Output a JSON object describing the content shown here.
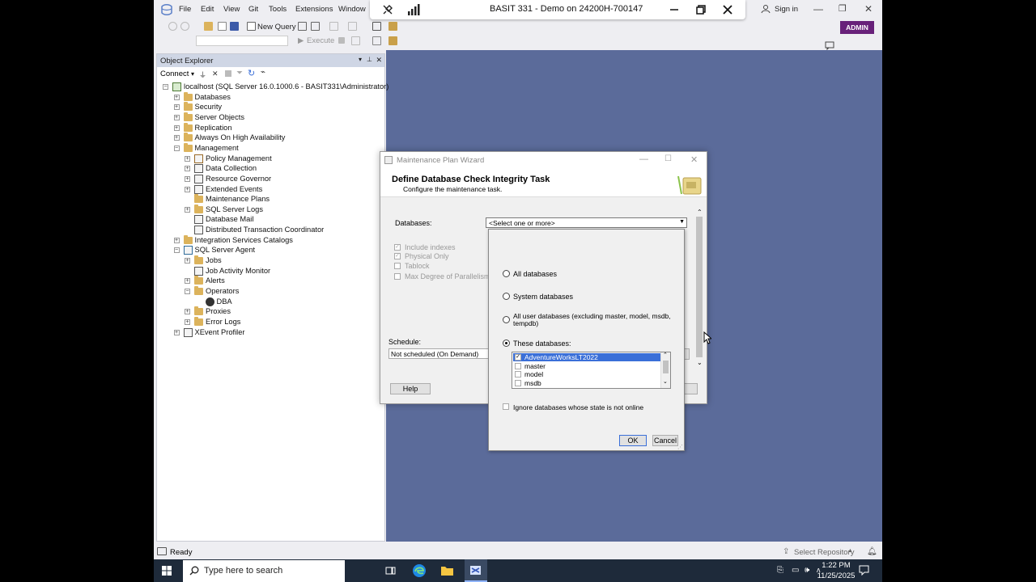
{
  "app": {
    "menu": [
      "File",
      "Edit",
      "View",
      "Git",
      "Tools",
      "Extensions",
      "Window"
    ],
    "sign_in": "Sign in",
    "admin": "ADMIN",
    "rdp_title": "BASIT 331 - Demo on 24200H-700147"
  },
  "toolbar": {
    "new_query": "New Query",
    "execute": "Execute"
  },
  "object_explorer": {
    "title": "Object Explorer",
    "connect": "Connect",
    "tree": [
      {
        "label": "localhost (SQL Server 16.0.1000.6 - BASIT331\\Administrator)",
        "level": 0,
        "exp": "-",
        "icon": "server"
      },
      {
        "label": "Databases",
        "level": 1,
        "exp": "+",
        "icon": "folder"
      },
      {
        "label": "Security",
        "level": 1,
        "exp": "+",
        "icon": "folder"
      },
      {
        "label": "Server Objects",
        "level": 1,
        "exp": "+",
        "icon": "folder"
      },
      {
        "label": "Replication",
        "level": 1,
        "exp": "+",
        "icon": "folder"
      },
      {
        "label": "Always On High Availability",
        "level": 1,
        "exp": "+",
        "icon": "folder"
      },
      {
        "label": "Management",
        "level": 1,
        "exp": "-",
        "icon": "folder"
      },
      {
        "label": "Policy Management",
        "level": 2,
        "exp": "+",
        "icon": "policy"
      },
      {
        "label": "Data Collection",
        "level": 2,
        "exp": "+",
        "icon": "datacollection"
      },
      {
        "label": "Resource Governor",
        "level": 2,
        "exp": "+",
        "icon": "governor"
      },
      {
        "label": "Extended Events",
        "level": 2,
        "exp": "+",
        "icon": "events"
      },
      {
        "label": "Maintenance Plans",
        "level": 2,
        "exp": "",
        "icon": "folder"
      },
      {
        "label": "SQL Server Logs",
        "level": 2,
        "exp": "+",
        "icon": "folder"
      },
      {
        "label": "Database Mail",
        "level": 2,
        "exp": "",
        "icon": "mail"
      },
      {
        "label": "Distributed Transaction Coordinator",
        "level": 2,
        "exp": "",
        "icon": "dtc"
      },
      {
        "label": "Integration Services Catalogs",
        "level": 1,
        "exp": "+",
        "icon": "folder"
      },
      {
        "label": "SQL Server Agent",
        "level": 1,
        "exp": "-",
        "icon": "agent"
      },
      {
        "label": "Jobs",
        "level": 2,
        "exp": "+",
        "icon": "folder"
      },
      {
        "label": "Job Activity Monitor",
        "level": 2,
        "exp": "",
        "icon": "monitor"
      },
      {
        "label": "Alerts",
        "level": 2,
        "exp": "+",
        "icon": "folder"
      },
      {
        "label": "Operators",
        "level": 2,
        "exp": "-",
        "icon": "folder"
      },
      {
        "label": "DBA",
        "level": 3,
        "exp": "",
        "icon": "user"
      },
      {
        "label": "Proxies",
        "level": 2,
        "exp": "+",
        "icon": "folder"
      },
      {
        "label": "Error Logs",
        "level": 2,
        "exp": "+",
        "icon": "folder"
      },
      {
        "label": "XEvent Profiler",
        "level": 1,
        "exp": "+",
        "icon": "events"
      }
    ]
  },
  "wizard": {
    "title": "Maintenance Plan Wizard",
    "header_title": "Define Database Check Integrity Task",
    "header_subtitle": "Configure the maintenance task.",
    "databases_label": "Databases:",
    "databases_value": "<Select one or more>",
    "include_indexes": "Include indexes",
    "physical_only": "Physical Only",
    "tablock": "Tablock",
    "max_dop": "Max Degree of Parallelism",
    "schedule_label": "Schedule:",
    "schedule_value": "Not scheduled (On Demand)",
    "help": "Help"
  },
  "popup": {
    "all_databases": "All databases",
    "system_databases": "System databases",
    "all_user_databases": "All user databases  (excluding master, model, msdb,",
    "all_user_databases_2": "tempdb)",
    "these_databases": "These databases:",
    "selected_option": "these",
    "databases": [
      {
        "name": "AdventureWorksLT2022",
        "checked": true,
        "selected": true
      },
      {
        "name": "master",
        "checked": false,
        "selected": false
      },
      {
        "name": "model",
        "checked": false,
        "selected": false
      },
      {
        "name": "msdb",
        "checked": false,
        "selected": false
      }
    ],
    "ignore_offline": "Ignore databases whose state is not online",
    "ok": "OK",
    "cancel": "Cancel"
  },
  "statusbar": {
    "ready": "Ready",
    "select_repository": "Select Repository"
  },
  "taskbar": {
    "search_placeholder": "Type here to search",
    "time": "1:22 PM",
    "date": "11/25/2025"
  },
  "colors": {
    "accent": "#68217a",
    "doc_bg": "#5b6b9a",
    "selection": "#3a6fd8"
  }
}
